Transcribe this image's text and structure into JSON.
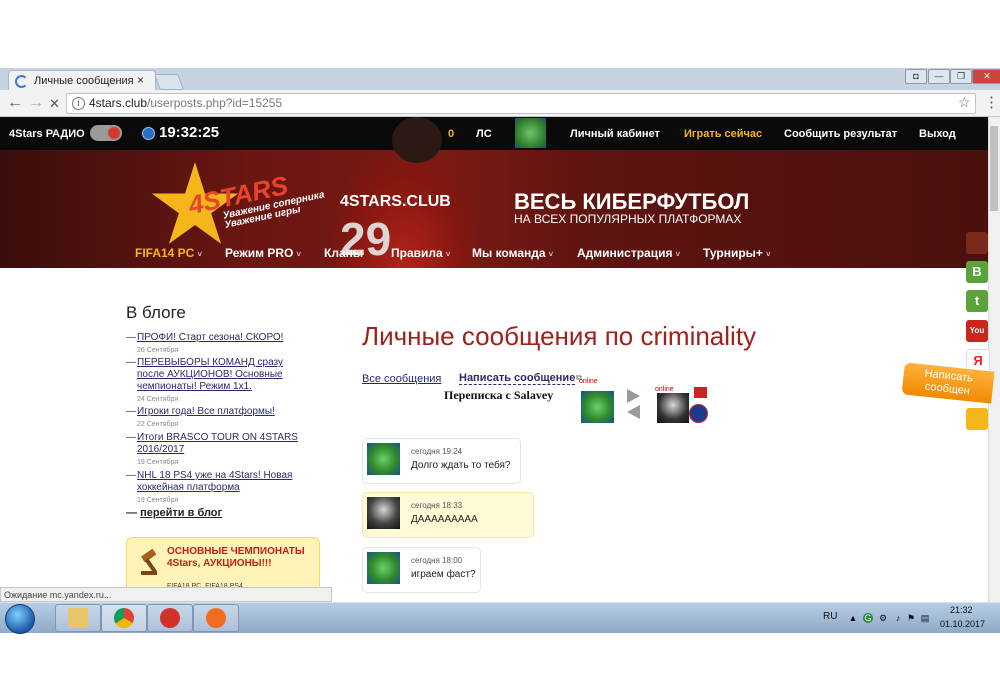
{
  "browser": {
    "tab_title": "Личные сообщения по",
    "tab_close": "×",
    "url_domain": "4stars.club",
    "url_path": "/userposts.php?id=15255",
    "back": "←",
    "forward": "→",
    "stop": "✕",
    "info": "i",
    "star": "☆",
    "menu": "⋮",
    "win_user": "",
    "win_min": "—",
    "win_max": "❐",
    "win_close": "✕"
  },
  "topbar": {
    "radio_label": "4Stars РАДИО",
    "clock": "19:32:25",
    "coins": "0",
    "ls": "ЛС",
    "cabinet": "Личный кабинет",
    "play_now": "Играть сейчас",
    "report": "Сообщить результат",
    "logout": "Выход",
    "play_color": "#f4b61a"
  },
  "banner": {
    "logo_text": "4STARS",
    "slogan_1": "Уважение соперника",
    "slogan_2": "Уважение игры",
    "jersey_text": "4STARS.CLUB",
    "jersey_number": "29",
    "headline": "ВЕСЬ КИБЕРФУТБОЛ",
    "subheadline": "НА ВСЕХ ПОПУЛЯРНЫХ ПЛАТФОРМАХ"
  },
  "sitenav": {
    "items": [
      {
        "label": "FIFA14 PC",
        "caret": true
      },
      {
        "label": "Режим PRO",
        "caret": true
      },
      {
        "label": "Кланы",
        "caret": false
      },
      {
        "label": "Правила",
        "caret": true
      },
      {
        "label": "Мы команда",
        "caret": true
      },
      {
        "label": "Администрация",
        "caret": true
      },
      {
        "label": "Турниры+",
        "caret": true
      }
    ],
    "caret_glyph": "˅"
  },
  "sidebar": {
    "title": "В блоге",
    "items": [
      {
        "text": "ПРОФИ! Старт сезона! СКОРО!",
        "date": "26 Сентября"
      },
      {
        "text": "ПЕРЕВЫБОРЫ КОМАНД сразу после АУКЦИОНОВ! Основные чемпионаты! Режим 1х1.",
        "date": "24 Сентября"
      },
      {
        "text": "Игроки года! Все платформы!",
        "date": "22 Сентября"
      },
      {
        "text": "Итоги BRASCO TOUR ON 4STARS 2016/2017",
        "date": "19 Сентября"
      },
      {
        "text": "NHL 18 PS4 уже на 4Stars! Новая хоккейная платформа",
        "date": "19 Сентября"
      }
    ],
    "more_link": "перейти в блог",
    "promo_title": "ОСНОВНЫЕ ЧЕМПИОНАТЫ 4Stars, АУКЦИОНЫ!!!",
    "promo_sub": "FIFA18 PC, FIFA18 PS4"
  },
  "main": {
    "page_title": "Личные сообщения по criminality",
    "all_messages": "Все сообщения",
    "write_message": "Написать сообщение",
    "correspondence": "Переписка с Salavey",
    "online_label": "online",
    "messages": [
      {
        "time": "сегодня 19:24",
        "text": "Долго ждать то тебя?",
        "avatar": "ball"
      },
      {
        "time": "сегодня 18:33",
        "text": "ДААААААААА",
        "avatar": "joker"
      },
      {
        "time": "сегодня 18:00",
        "text": "играем фаст?",
        "avatar": "ball"
      }
    ]
  },
  "side_widget": {
    "write_tab": "Написать сообщен",
    "vk": "B",
    "twitter": "t",
    "youtube": "You",
    "yandex": "Я"
  },
  "statusbar": {
    "text": "Ожидание mc.yandex.ru..."
  },
  "taskbar": {
    "lang": "RU",
    "time": "21:32",
    "date": "01.10.2017"
  }
}
